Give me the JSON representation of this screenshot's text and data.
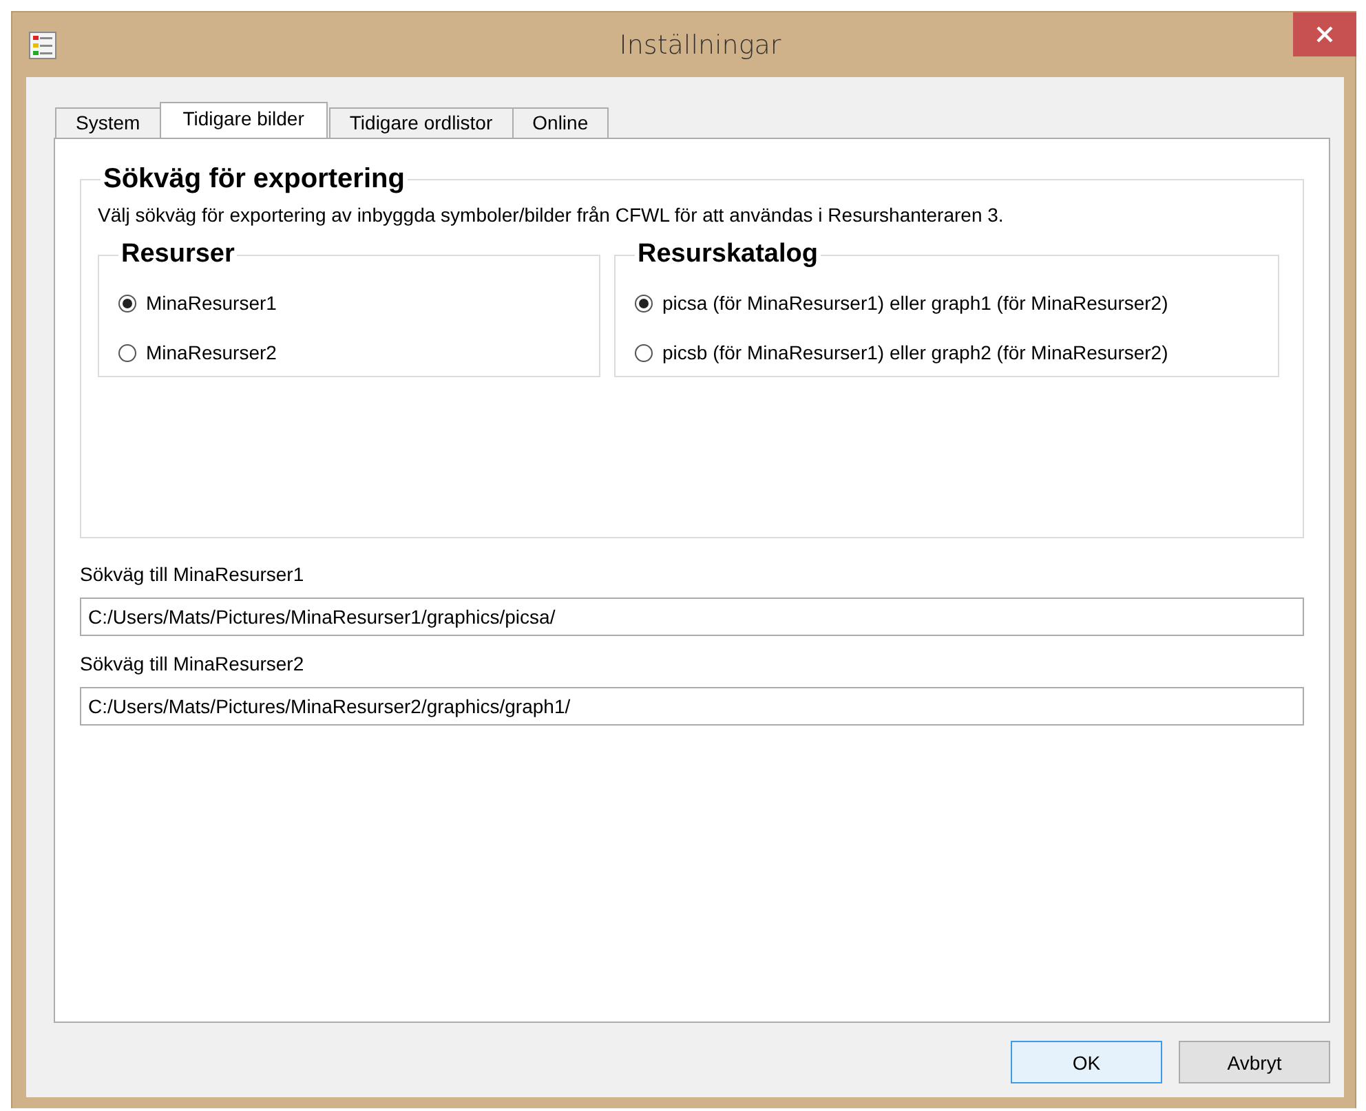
{
  "window": {
    "title": "Inställningar"
  },
  "tabs": [
    {
      "label": "System",
      "selected": false
    },
    {
      "label": "Tidigare bilder",
      "selected": true
    },
    {
      "label": "Tidigare ordlistor",
      "selected": false
    },
    {
      "label": "Online",
      "selected": false
    }
  ],
  "export_group": {
    "title": "Sökväg för exportering",
    "description": "Välj sökväg för exportering av inbyggda symboler/bilder från CFWL för att användas i Resurshanteraren 3.",
    "groups": [
      {
        "title": "Resurser",
        "options": [
          {
            "label": "MinaResurser1",
            "selected": true
          },
          {
            "label": "MinaResurser2",
            "selected": false
          }
        ]
      },
      {
        "title": "Resurskatalog",
        "options": [
          {
            "label": "picsa (för MinaResurser1) eller graph1 (för MinaResurser2)",
            "selected": true
          },
          {
            "label": "picsb (för MinaResurser1) eller graph2 (för MinaResurser2)",
            "selected": false
          }
        ]
      }
    ]
  },
  "paths": [
    {
      "label": "Sökväg till MinaResurser1",
      "value": "C:/Users/Mats/Pictures/MinaResurser1/graphics/picsa/"
    },
    {
      "label": "Sökväg till MinaResurser2",
      "value": "C:/Users/Mats/Pictures/MinaResurser2/graphics/graph1/"
    }
  ],
  "buttons": [
    {
      "label": "OK",
      "focused": true
    },
    {
      "label": "Avbryt",
      "focused": false
    }
  ]
}
